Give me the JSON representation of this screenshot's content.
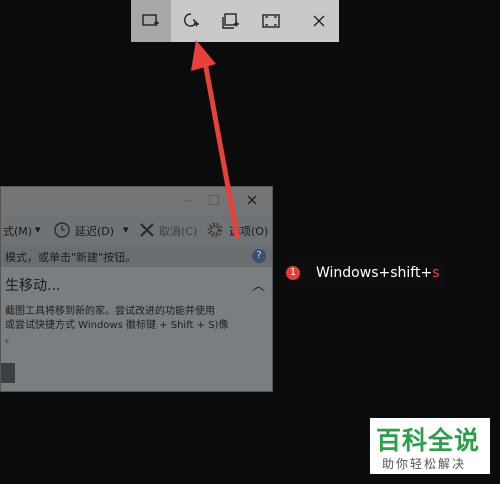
{
  "snip_toolbar": {
    "buttons": [
      {
        "name": "rectangular-snip",
        "active": true
      },
      {
        "name": "freeform-snip",
        "active": false
      },
      {
        "name": "window-snip",
        "active": false
      },
      {
        "name": "fullscreen-snip",
        "active": false
      },
      {
        "name": "close",
        "active": false
      }
    ],
    "active_color": "#a8a8a8",
    "bar_color": "#c9c9c9"
  },
  "snipping_window": {
    "toolbar": {
      "mode_label": "式(M)",
      "delay_label": "延迟(D)",
      "cancel_label": "取消(C)",
      "options_label": "选项(O)"
    },
    "hint": "模式，或单击\"新建\"按钮。",
    "section_title": "生移动...",
    "paragraph_lines": [
      "截图工具将移到新的家。尝试改进的功能并使用",
      "或尝试快捷方式 Windows 徽标键 + Shift + S)像",
      "。"
    ]
  },
  "tag": {
    "number": "1",
    "text": "Windows+shift+",
    "suffix": "s",
    "badge_color": "#e43c37"
  },
  "watermark": {
    "main": "百科全说",
    "sub": "助你轻松解决",
    "color": "#2b9f4a"
  },
  "arrow_color": "#e8413c"
}
